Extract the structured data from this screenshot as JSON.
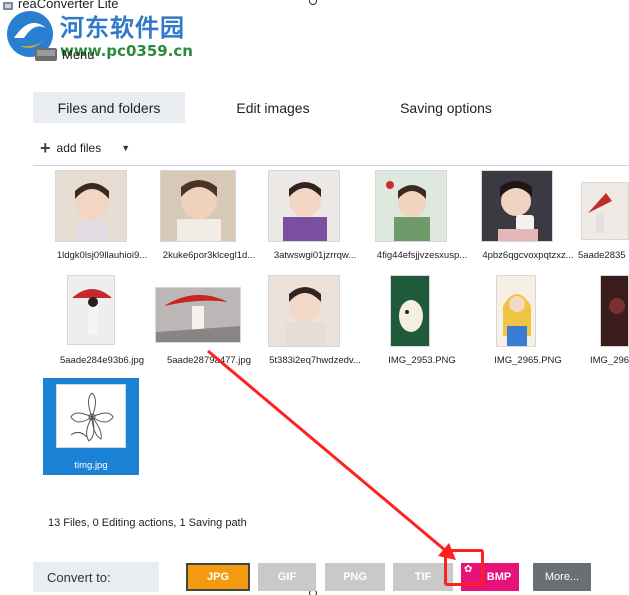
{
  "window": {
    "app_title": "reaConverter Lite",
    "menu_label": "Menu"
  },
  "watermark": {
    "site_name": "河东软件园",
    "site_url": "www.pc0359.cn"
  },
  "tabs": [
    {
      "label": "Files and folders",
      "active": true
    },
    {
      "label": "Edit images",
      "active": false
    },
    {
      "label": "Saving options",
      "active": false
    }
  ],
  "toolbar": {
    "add_files_label": "add files",
    "add_icon": "plus-icon",
    "dropdown_icon": "chevron-down-icon"
  },
  "files": [
    {
      "name": "1ldgk0lsj09llauhioi9...",
      "selected": false,
      "tone": "#d9c2b0"
    },
    {
      "name": "2kuke6por3klcegl1d...",
      "selected": false,
      "tone": "#cbb8a6"
    },
    {
      "name": "3atwswgi01jzrrqw...",
      "selected": false,
      "tone": "#8d6aa8"
    },
    {
      "name": "4fig44efsjjvzesxusp...",
      "selected": false,
      "tone": "#9db79a"
    },
    {
      "name": "4pbz6qgcvoxpqtzxz...",
      "selected": false,
      "tone": "#3b3a42"
    },
    {
      "name": "5aade2835",
      "selected": false,
      "tone": "#e6e1dc"
    },
    {
      "name": "5aade284e93b6.jpg",
      "selected": false,
      "tone": "#e6e6e6"
    },
    {
      "name": "5aade2879a477.jpg",
      "selected": false,
      "tone": "#b9b3b3"
    },
    {
      "name": "5t383i2eq7hwdzedv...",
      "selected": false,
      "tone": "#e9dcd2"
    },
    {
      "name": "IMG_2953.PNG",
      "selected": false,
      "tone": "#1f5b3a"
    },
    {
      "name": "IMG_2965.PNG",
      "selected": false,
      "tone": "#f0d060"
    },
    {
      "name": "IMG_296",
      "selected": false,
      "tone": "#3a2020"
    },
    {
      "name": "timg.jpg",
      "selected": true,
      "tone": "#ffffff"
    }
  ],
  "status": {
    "summary": "13 Files, 0 Editing actions, 1 Saving path"
  },
  "convert": {
    "label": "Convert to:",
    "formats": [
      {
        "label": "JPG",
        "color": "#f39a10",
        "active": true
      },
      {
        "label": "GIF",
        "color": "#c9c9c9"
      },
      {
        "label": "PNG",
        "color": "#c9c9c9"
      },
      {
        "label": "TIF",
        "color": "#c9c9c9"
      },
      {
        "label": "BMP",
        "color": "#e8117a"
      }
    ],
    "more_label": "More..."
  },
  "annotation": {
    "color": "#ff2020"
  }
}
